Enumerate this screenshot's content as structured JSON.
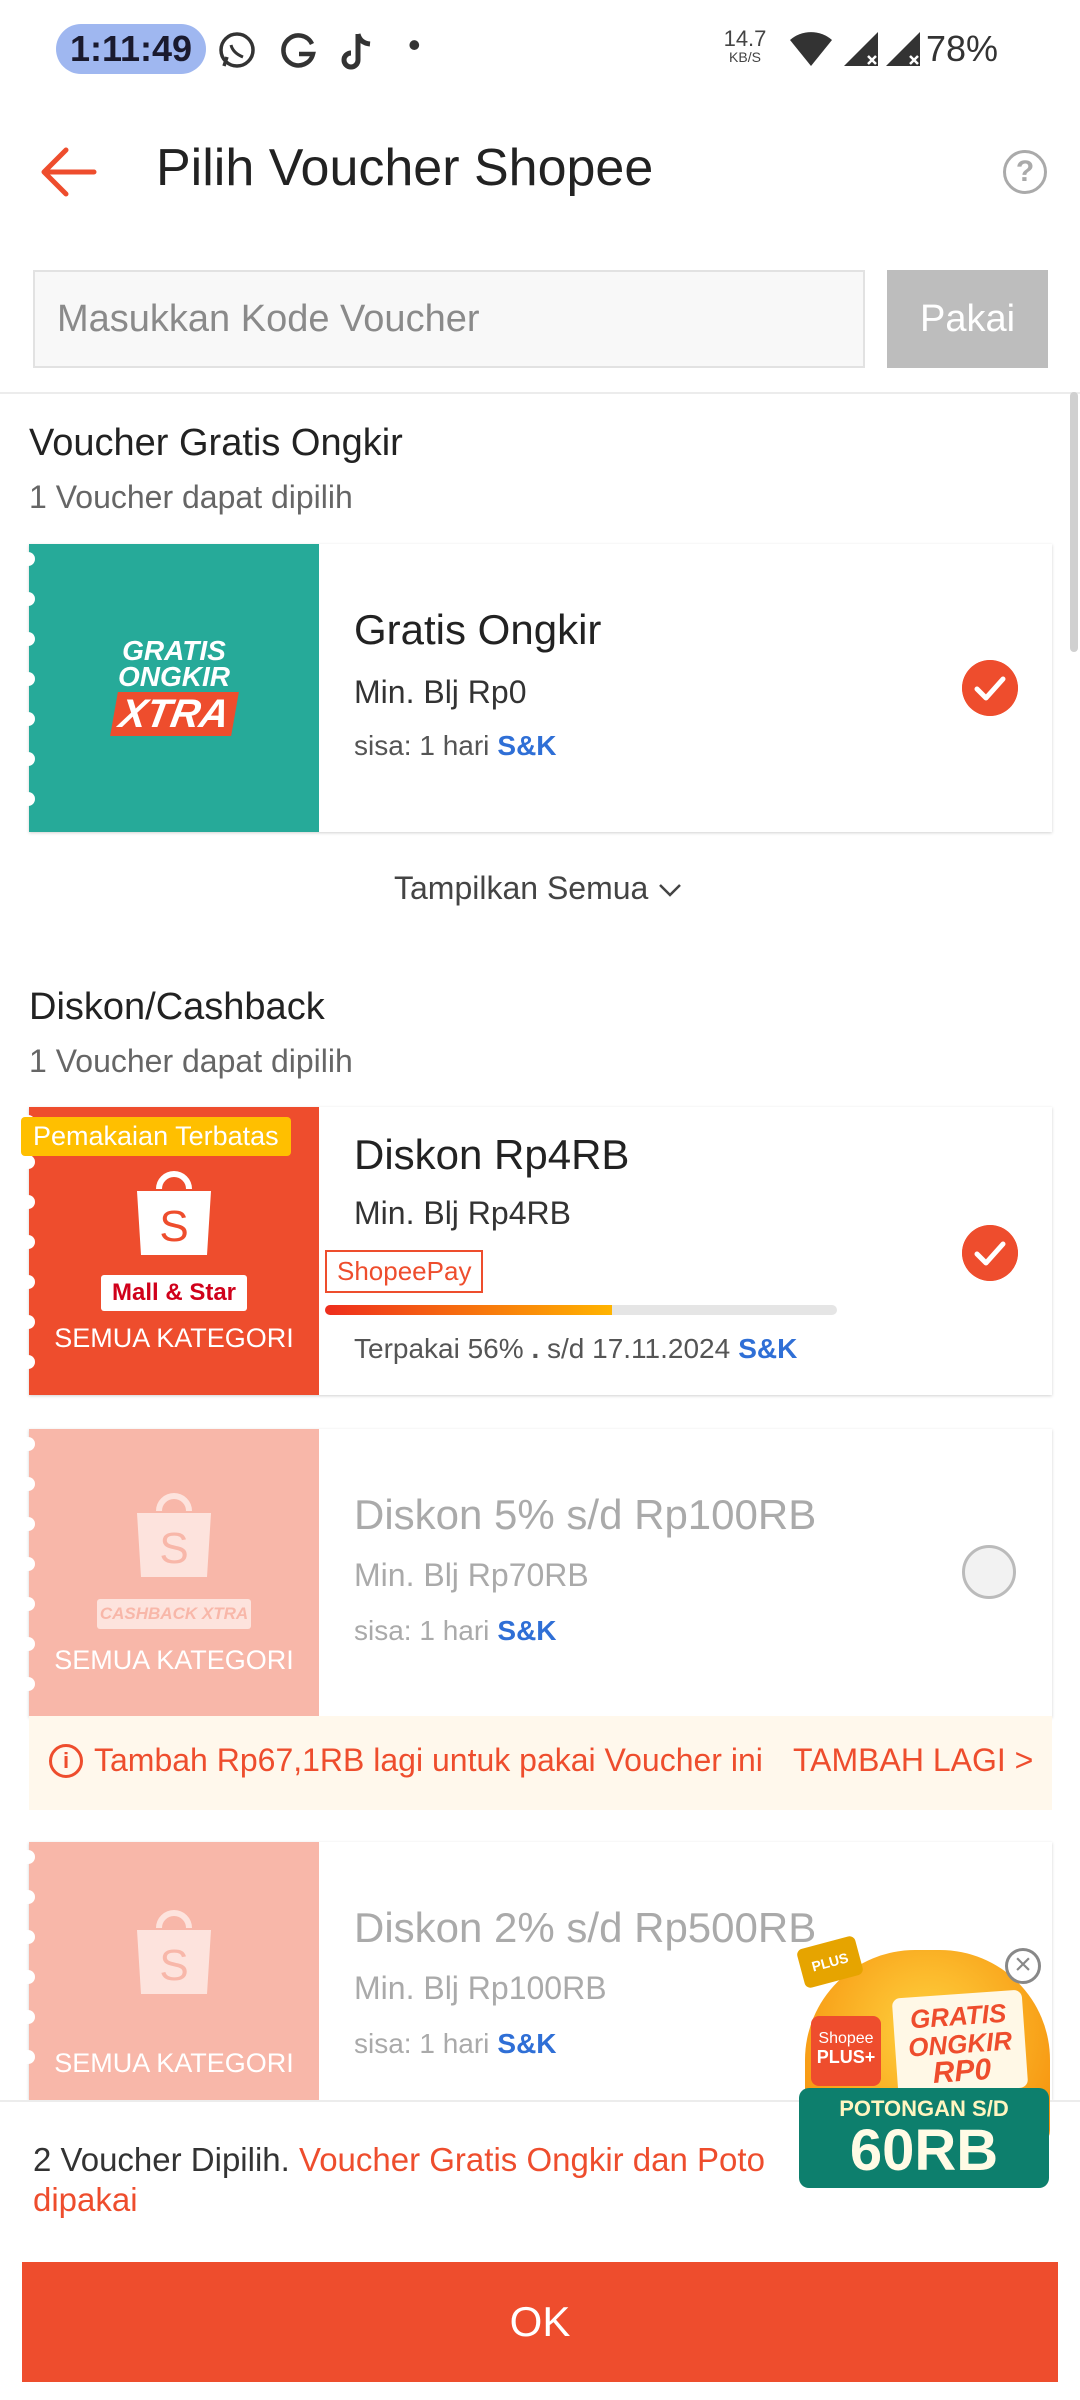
{
  "status_bar": {
    "time": "1:11:49",
    "speed": "14.7",
    "speed_unit": "KB/S",
    "battery": "78%",
    "dot": "•"
  },
  "header": {
    "title": "Pilih Voucher Shopee",
    "help": "?"
  },
  "voucher_input": {
    "placeholder": "Masukkan Kode Voucher",
    "apply_label": "Pakai"
  },
  "section_shipping": {
    "title": "Voucher Gratis Ongkir",
    "subtitle": "1 Voucher dapat dipilih",
    "voucher": {
      "logo_line1": "GRATIS",
      "logo_line2": "ONGKIR",
      "logo_line3": "XTRA",
      "title": "Gratis Ongkir",
      "min_spend": "Min. Blj Rp0",
      "remaining": "sisa: 1 hari",
      "terms": "S&K",
      "selected": true
    },
    "show_all": "Tampilkan Semua"
  },
  "section_discount": {
    "title": "Diskon/Cashback",
    "subtitle": "1 Voucher dapat dipilih",
    "vouchers": [
      {
        "badge": "Pemakaian Terbatas",
        "brand_tag": "Mall & Star",
        "category": "SEMUA KATEGORI",
        "title": "Diskon Rp4RB",
        "min_spend": "Min. Blj Rp4RB",
        "payment_tag": "ShopeePay",
        "usage_percent": 56,
        "usage": "Terpakai 56%",
        "separator": ".",
        "valid_until": "s/d 17.11.2024",
        "terms": "S&K",
        "selected": true
      },
      {
        "brand_tag": "CASHBACK XTRA",
        "category": "SEMUA KATEGORI",
        "title": "Diskon 5% s/d Rp100RB",
        "min_spend": "Min. Blj Rp70RB",
        "remaining": "sisa: 1 hari",
        "terms": "S&K",
        "selected": false,
        "warning": "Tambah Rp67,1RB lagi untuk pakai Voucher ini",
        "warning_action": "TAMBAH LAGI >"
      },
      {
        "category": "SEMUA KATEGORI",
        "title": "Diskon 2% s/d Rp500RB",
        "min_spend": "Min. Blj Rp100RB",
        "remaining": "sisa: 1 hari",
        "terms": "S&K",
        "selected": false
      }
    ]
  },
  "footer": {
    "count_text": "2 Voucher Dipilih.",
    "highlight_text": "Voucher Gratis Ongkir dan Poto",
    "highlight_text_line2": "dipakai",
    "ok_label": "OK"
  },
  "promo": {
    "plus": "PLUS",
    "brand": "Shopee",
    "plus_badge": "PLUS+",
    "line1": "GRATIS",
    "line2": "ONGKIR",
    "line3": "RP0",
    "banner_small": "POTONGAN S/D",
    "banner_big": "60RB",
    "close": "×"
  },
  "colors": {
    "brand": "#ee4d2d",
    "teal": "#26aa99",
    "link": "#2f6fd6"
  }
}
